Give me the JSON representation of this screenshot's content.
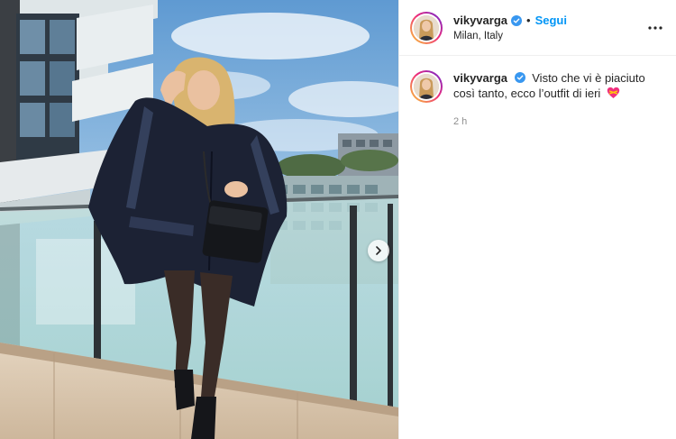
{
  "post": {
    "username": "vikyvarga",
    "follow_label": "Segui",
    "separator": "•",
    "location": "Milan, Italy",
    "more_icon": "more-horizontal-icon",
    "caption": "Visto che vi è piaciuto così tanto, ecco l’outfit di ieri",
    "caption_emoji": "heart-with-ribbon-icon",
    "timestamp": "2 h"
  },
  "photo": {
    "next_icon": "chevron-right-icon",
    "subject": "photo of woman in navy poncho on balcony"
  },
  "colors": {
    "accent": "#0095f6",
    "verified": "#3897f0",
    "text": "#262626",
    "muted": "#8e8e8e",
    "sky": "#7fb2dd",
    "poncho": "#1c2234"
  }
}
